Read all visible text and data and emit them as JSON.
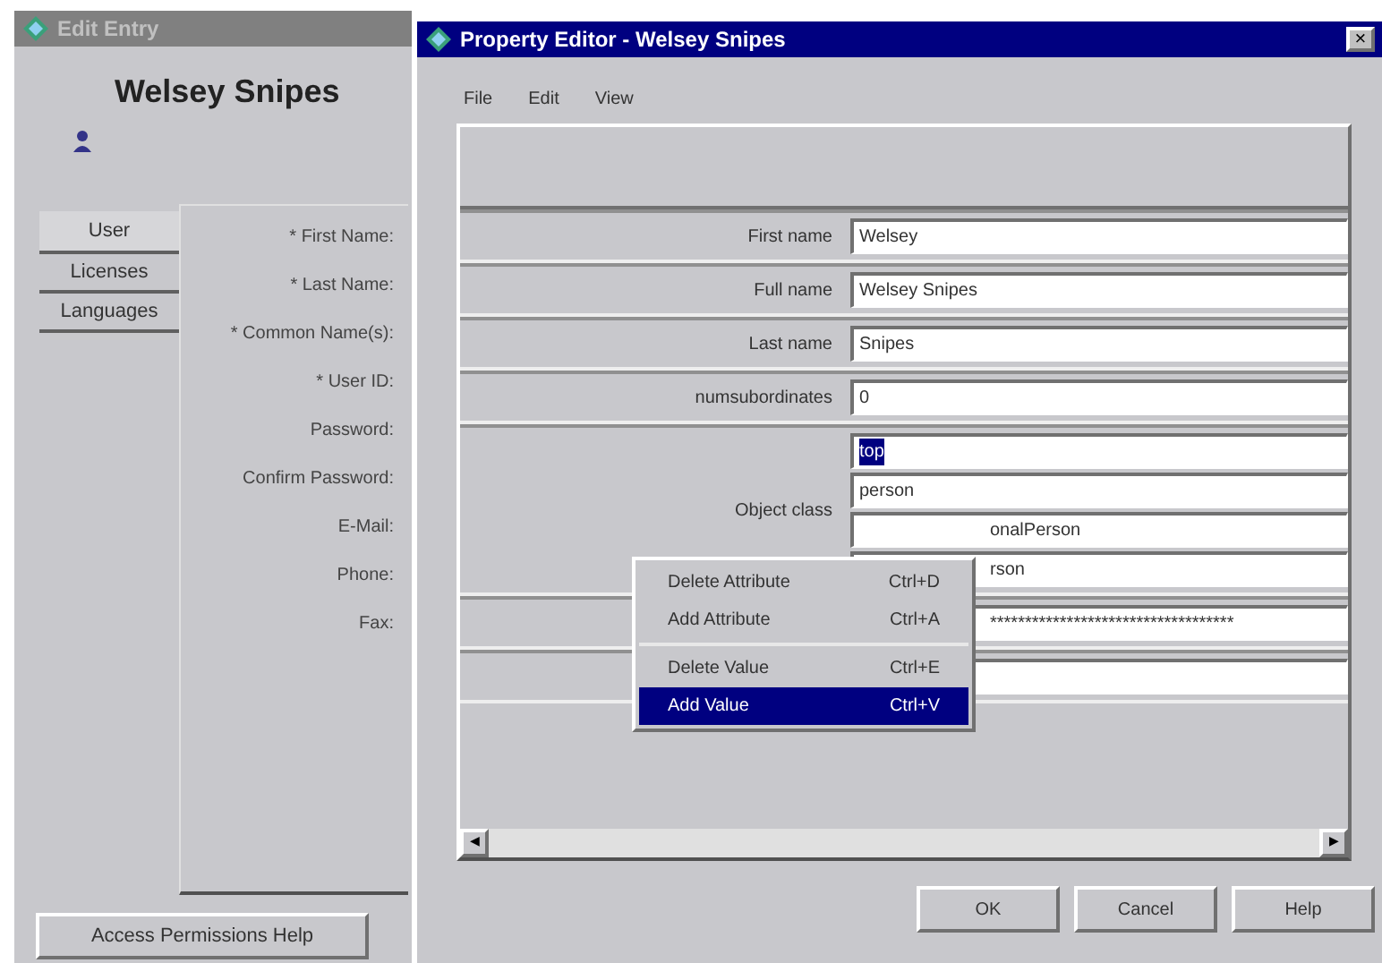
{
  "edit_entry": {
    "title": "Edit Entry",
    "active": false,
    "name": "Welsey Snipes",
    "tabs": [
      {
        "label": "User",
        "selected": true
      },
      {
        "label": "Licenses",
        "selected": false
      },
      {
        "label": "Languages",
        "selected": false
      }
    ],
    "labels": [
      "* First Name:",
      "* Last Name:",
      "* Common Name(s):",
      "* User ID:",
      "Password:",
      "Confirm Password:",
      "E-Mail:",
      "Phone:",
      "Fax:"
    ],
    "help_button": "Access Permissions Help"
  },
  "property_editor": {
    "title": "Property Editor - Welsey Snipes",
    "active": true,
    "close": "×",
    "menu": [
      "File",
      "Edit",
      "View"
    ],
    "attributes": [
      {
        "kind": "values",
        "label": "First name",
        "values": [
          {
            "text": "Welsey",
            "selected": false
          }
        ]
      },
      {
        "kind": "values",
        "label": "Full name",
        "values": [
          {
            "text": "Welsey Snipes",
            "selected": false
          }
        ]
      },
      {
        "kind": "values",
        "label": "Last name",
        "values": [
          {
            "text": "Snipes",
            "selected": false
          }
        ]
      },
      {
        "kind": "values",
        "label": "numsubordinates",
        "values": [
          {
            "text": "0",
            "selected": false
          }
        ]
      },
      {
        "kind": "values",
        "label": "Object class",
        "values": [
          {
            "text": "top",
            "selected": true
          },
          {
            "text": "person",
            "selected": false
          },
          {
            "text": "onalPerson",
            "selected": false,
            "covered": true
          },
          {
            "text": "rson",
            "selected": false,
            "covered": true
          }
        ]
      },
      {
        "kind": "values",
        "values": [
          {
            "text": "***********************************",
            "selected": false,
            "covered": true
          }
        ]
      },
      {
        "kind": "empty"
      }
    ],
    "context_menu": [
      {
        "label": "Delete Attribute",
        "shortcut": "Ctrl+D",
        "selected": false,
        "separator_after": false
      },
      {
        "label": "Add Attribute",
        "shortcut": "Ctrl+A",
        "selected": false,
        "separator_after": true
      },
      {
        "label": "Delete Value",
        "shortcut": "Ctrl+E",
        "selected": false,
        "separator_after": false
      },
      {
        "label": "Add Value",
        "shortcut": "Ctrl+V",
        "selected": true,
        "separator_after": false
      }
    ],
    "scroll_left": "◀",
    "scroll_right": "▶",
    "buttons": [
      "OK",
      "Cancel",
      "Help"
    ]
  }
}
